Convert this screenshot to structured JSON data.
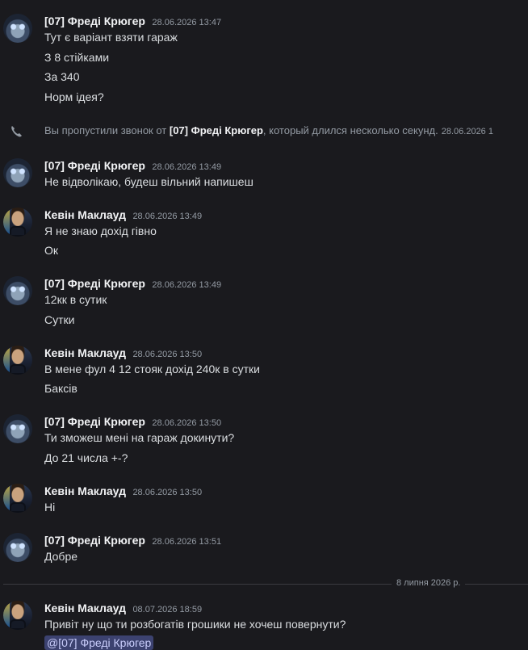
{
  "messages": [
    {
      "author": "[07] Фреді Крюгер",
      "time": "28.06.2026 13:47",
      "lines": [
        "Тут є варіант взяти гараж",
        "З 8 стійками",
        "За 340",
        "Норм ідея?"
      ]
    },
    {
      "author": "[07] Фреді Крюгер",
      "time": "28.06.2026 13:49",
      "lines": [
        "Не відволікаю, будеш вільний напишеш"
      ]
    },
    {
      "author": "Кевін Маклауд",
      "time": "28.06.2026 13:49",
      "lines": [
        "Я не знаю дохід гівно",
        "Ок"
      ]
    },
    {
      "author": "[07] Фреді Крюгер",
      "time": "28.06.2026 13:49",
      "lines": [
        "12кк в сутик",
        "Сутки"
      ]
    },
    {
      "author": "Кевін Маклауд",
      "time": "28.06.2026 13:50",
      "lines": [
        "В мене фул 4 12 стояк дохід 240к в сутки",
        "Баксів"
      ]
    },
    {
      "author": "[07] Фреді Крюгер",
      "time": "28.06.2026 13:50",
      "lines": [
        "Ти зможеш мені на гараж докинути?",
        "До 21 числа +-?"
      ]
    },
    {
      "author": "Кевін Маклауд",
      "time": "28.06.2026 13:50",
      "lines": [
        "Ні"
      ]
    },
    {
      "author": "[07] Фреді Крюгер",
      "time": "28.06.2026 13:51",
      "lines": [
        "Добре"
      ]
    },
    {
      "author": "Кевін Маклауд",
      "time": "08.07.2026 18:59",
      "lines": [
        "Привіт ну що ти розбогатів грошики не хочеш повернути?"
      ],
      "mention": "@[07] Фреді Крюгер"
    }
  ],
  "system": {
    "prefix": "Вы пропустили звонок от ",
    "name": "[07] Фреді Крюгер",
    "suffix": ", который длился несколько секунд.",
    "time": "28.06.2026 1"
  },
  "divider_label": "8 липня 2026 р.",
  "icons": {
    "call": "phone-missed-icon"
  }
}
